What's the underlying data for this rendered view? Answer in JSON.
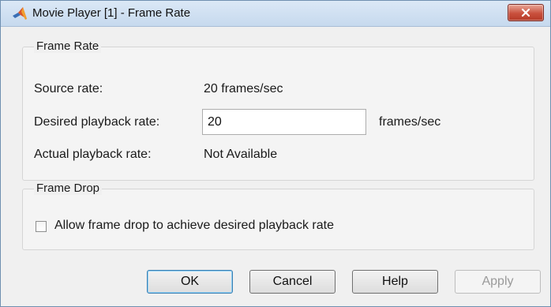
{
  "window": {
    "title": "Movie Player [1] - Frame Rate",
    "close_label": "close"
  },
  "frame_rate": {
    "group_title": "Frame Rate",
    "source_label": "Source rate:",
    "source_value": "20 frames/sec",
    "desired_label": "Desired playback rate:",
    "desired_value": "20",
    "desired_units": "frames/sec",
    "actual_label": "Actual playback rate:",
    "actual_value": "Not Available"
  },
  "frame_drop": {
    "group_title": "Frame Drop",
    "checkbox_label": "Allow frame drop to achieve desired playback rate",
    "checked": false
  },
  "buttons": {
    "ok": "OK",
    "cancel": "Cancel",
    "help": "Help",
    "apply": "Apply"
  },
  "icons": {
    "app": "matlab-logo-icon",
    "close": "close-icon"
  },
  "colors": {
    "titlebar": "#c6d9ee",
    "close_button": "#c9503d",
    "default_button_border": "#3c7fb1"
  }
}
